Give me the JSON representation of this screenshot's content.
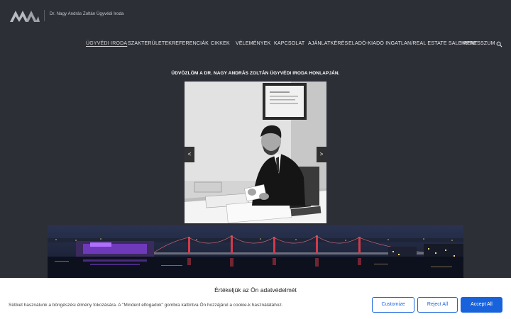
{
  "header": {
    "site_name": "Dr. Nagy András Zoltán Ügyvédi Iroda",
    "logo_icon": "ma-logo-icon"
  },
  "nav": {
    "items": [
      {
        "label": "ÜGYVÉDI IRODA",
        "active": true
      },
      {
        "label": "SZAKTERÜLETEK"
      },
      {
        "label": "REFERENCIÁK"
      },
      {
        "label": "CIKKEK"
      },
      {
        "label": "VÉLEMÉNYEK"
      },
      {
        "label": "KAPCSOLAT"
      },
      {
        "label": "AJÁNLATKÉRÉS"
      },
      {
        "label": "ELADÓ-KIADÓ INGATLAN/REAL ESTATE SALE-RENT"
      },
      {
        "label": "IMPRESSZUM"
      }
    ],
    "search_icon": "search-icon"
  },
  "main": {
    "welcome": "ÜDVÖZLÖM A DR. NAGY ANDRÁS ZOLTÁN ÜGYVÉDI IRODA HONLAPJÁN.",
    "slider": {
      "prev_label": "<",
      "next_label": ">"
    }
  },
  "cookie": {
    "title": "Értékeljük az Ön adatvédelmét",
    "text": "Sütiket használunk a böngészési élmény fokozására. A \"Mindent elfogadok\" gombra kattintva Ön hozzájárul a cookie-k használatához.",
    "customize": "Customize",
    "reject": "Reject All",
    "accept": "Accept All",
    "accent_color": "#1863dc"
  }
}
